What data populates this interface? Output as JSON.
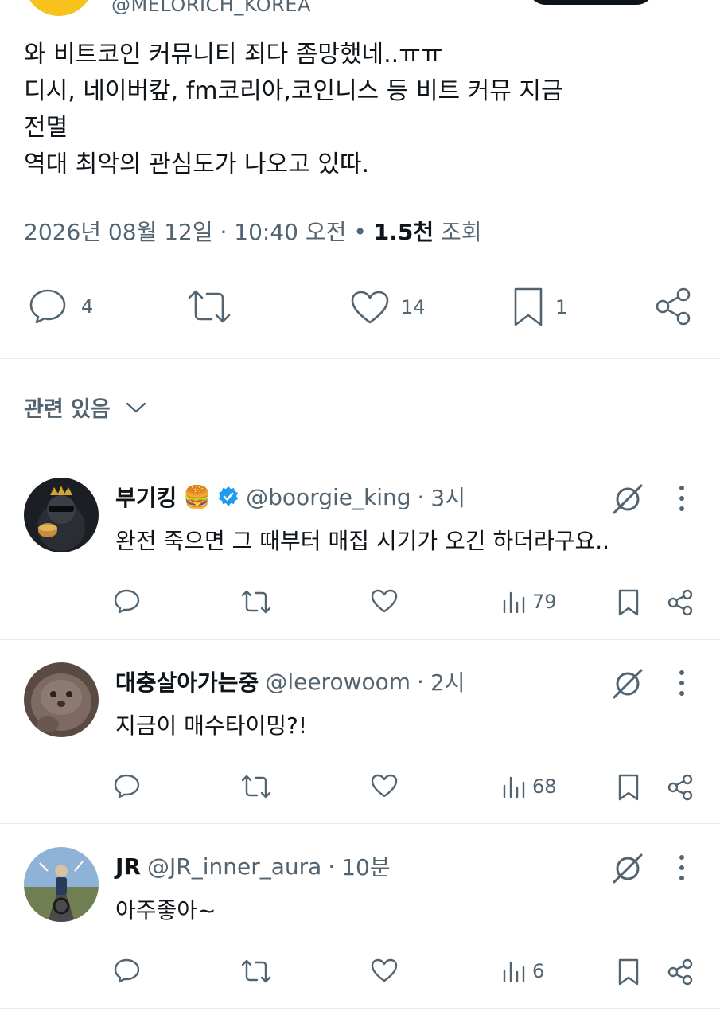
{
  "author": {
    "handle": "@MELORICH_KOREA"
  },
  "tweet": {
    "lines": [
      "와 비트코인 커뮤니티 죄다 좀망했네..ㅠㅠ",
      "디시, 네이버캎, fm코리아,코인니스 등 비트 커뮤 지금",
      "전멸",
      "역대 최악의 관심도가 나오고 있따."
    ],
    "date": "2026년 08월 12일 · 10:40 오전",
    "separator": " • ",
    "views_count": "1.5천",
    "views_label": " 조회",
    "reply_count": "4",
    "like_count": "14",
    "bookmark_count": "1"
  },
  "related": {
    "label": "관련 있음"
  },
  "replies": [
    {
      "name": "부기킹",
      "emoji": "🍔",
      "verified": true,
      "handle": "@boorgie_king",
      "dot": "·",
      "time": "3시",
      "text": "완전 죽으면 그 때부터 매집 시기가 오긴 하더라구요..",
      "views": "79"
    },
    {
      "name": "대충살아가는중",
      "verified": false,
      "handle": "@leerowoom",
      "dot": "·",
      "time": "2시",
      "text": "지금이 매수타이밍?!",
      "views": "68"
    },
    {
      "name": "JR",
      "verified": false,
      "handle": "@JR_inner_aura",
      "dot": "·",
      "time": "10분",
      "text": "아주좋아~",
      "views": "6"
    }
  ],
  "colors": {
    "text": "#0f1419",
    "secondary": "#536471",
    "verified": "#1d9bf0",
    "divider": "#e7e9ea"
  },
  "icons": [
    "reply-icon",
    "retweet-icon",
    "like-icon",
    "bookmark-icon",
    "share-icon",
    "chevron-down-icon",
    "verified-icon",
    "grok-icon",
    "more-icon",
    "views-icon"
  ]
}
